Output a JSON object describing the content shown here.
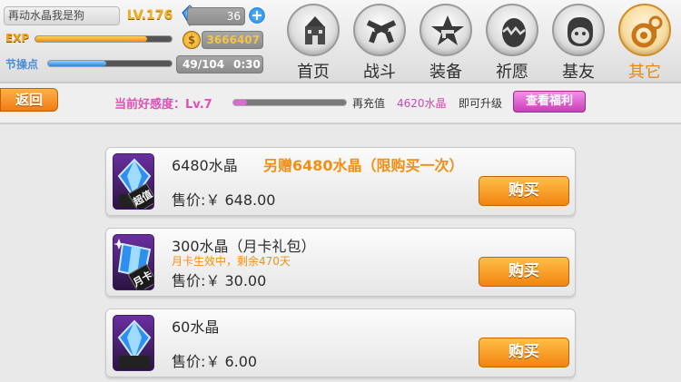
{
  "player": {
    "nickname": "再动水晶我是狗",
    "level": "LV.176",
    "gems": "36",
    "exp_label": "EXP",
    "exp_progress": 0.82,
    "gold": "3666407",
    "ap_label": "节操点",
    "ap_progress": 0.47,
    "ap_value": "49/104",
    "ap_timer": "0:30"
  },
  "nav": [
    {
      "label": "首页",
      "icon": "castle-icon"
    },
    {
      "label": "战斗",
      "icon": "crossed-guns-icon"
    },
    {
      "label": "装备",
      "icon": "star-gun-icon"
    },
    {
      "label": "祈愿",
      "icon": "egg-icon"
    },
    {
      "label": "基友",
      "icon": "face-icon"
    },
    {
      "label": "其它",
      "icon": "gear-key-icon"
    }
  ],
  "subbar": {
    "back_label": "返回",
    "favor_label": "当前好感度：Lv.7",
    "favor_progress": 0.12,
    "recharge_label": "再充值",
    "recharge_amount": "4620水晶",
    "upgrade_label": "即可升级",
    "benefit_label": "查看福利"
  },
  "products": [
    {
      "title": "6480水晶",
      "bonus": "另赠6480水晶（限购买一次）",
      "sub": "",
      "price": "售价:￥ 648.00",
      "badge": "超值",
      "buy_label": "购买"
    },
    {
      "title": "300水晶（月卡礼包）",
      "bonus": "",
      "sub": "月卡生效中，剩余470天",
      "price": "售价:￥ 30.00",
      "badge": "月卡",
      "buy_label": "购买"
    },
    {
      "title": "60水晶",
      "bonus": "",
      "sub": "",
      "price": "售价:￥ 6.00",
      "badge": "",
      "buy_label": "购买"
    }
  ],
  "colors": {
    "accent_orange": "#f08f13",
    "favor_pink": "#e04fb4"
  }
}
